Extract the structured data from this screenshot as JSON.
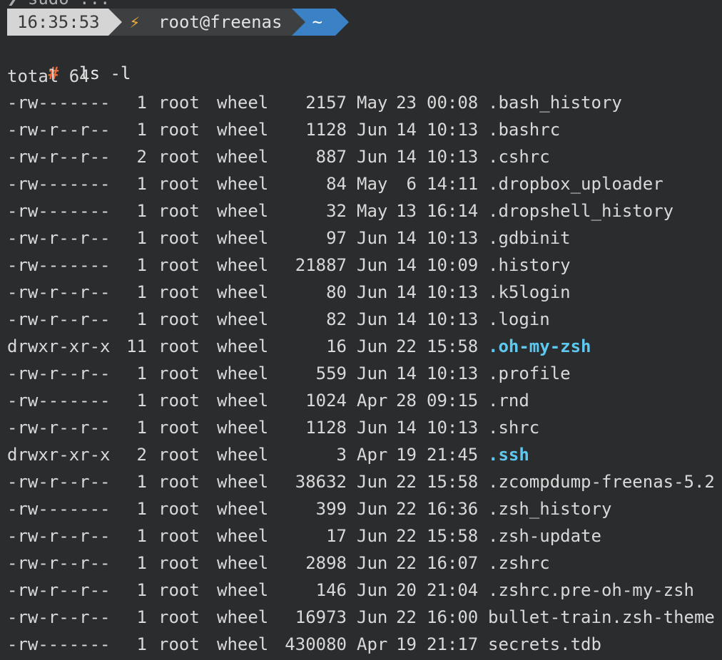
{
  "clipped_line": "❯ sudo ... ",
  "prompt": {
    "time": "16:35:53",
    "status_icon": "⚡",
    "context": "root@freenas",
    "directory": "~"
  },
  "command": {
    "symbol": "#",
    "text": "ls -l"
  },
  "total": "total 64",
  "listing": [
    {
      "perm": "-rw-------",
      "links": "1",
      "user": "root",
      "group": "wheel",
      "size": "2157",
      "month": "May",
      "day": "23",
      "time": "00:08",
      "name": ".bash_history",
      "is_dir": false
    },
    {
      "perm": "-rw-r--r--",
      "links": "1",
      "user": "root",
      "group": "wheel",
      "size": "1128",
      "month": "Jun",
      "day": "14",
      "time": "10:13",
      "name": ".bashrc",
      "is_dir": false
    },
    {
      "perm": "-rw-r--r--",
      "links": "2",
      "user": "root",
      "group": "wheel",
      "size": "887",
      "month": "Jun",
      "day": "14",
      "time": "10:13",
      "name": ".cshrc",
      "is_dir": false
    },
    {
      "perm": "-rw-------",
      "links": "1",
      "user": "root",
      "group": "wheel",
      "size": "84",
      "month": "May",
      "day": "6",
      "time": "14:11",
      "name": ".dropbox_uploader",
      "is_dir": false
    },
    {
      "perm": "-rw-------",
      "links": "1",
      "user": "root",
      "group": "wheel",
      "size": "32",
      "month": "May",
      "day": "13",
      "time": "16:14",
      "name": ".dropshell_history",
      "is_dir": false
    },
    {
      "perm": "-rw-r--r--",
      "links": "1",
      "user": "root",
      "group": "wheel",
      "size": "97",
      "month": "Jun",
      "day": "14",
      "time": "10:13",
      "name": ".gdbinit",
      "is_dir": false
    },
    {
      "perm": "-rw-------",
      "links": "1",
      "user": "root",
      "group": "wheel",
      "size": "21887",
      "month": "Jun",
      "day": "14",
      "time": "10:09",
      "name": ".history",
      "is_dir": false
    },
    {
      "perm": "-rw-r--r--",
      "links": "1",
      "user": "root",
      "group": "wheel",
      "size": "80",
      "month": "Jun",
      "day": "14",
      "time": "10:13",
      "name": ".k5login",
      "is_dir": false
    },
    {
      "perm": "-rw-r--r--",
      "links": "1",
      "user": "root",
      "group": "wheel",
      "size": "82",
      "month": "Jun",
      "day": "14",
      "time": "10:13",
      "name": ".login",
      "is_dir": false
    },
    {
      "perm": "drwxr-xr-x",
      "links": "11",
      "user": "root",
      "group": "wheel",
      "size": "16",
      "month": "Jun",
      "day": "22",
      "time": "15:58",
      "name": ".oh-my-zsh",
      "is_dir": true
    },
    {
      "perm": "-rw-r--r--",
      "links": "1",
      "user": "root",
      "group": "wheel",
      "size": "559",
      "month": "Jun",
      "day": "14",
      "time": "10:13",
      "name": ".profile",
      "is_dir": false
    },
    {
      "perm": "-rw-------",
      "links": "1",
      "user": "root",
      "group": "wheel",
      "size": "1024",
      "month": "Apr",
      "day": "28",
      "time": "09:15",
      "name": ".rnd",
      "is_dir": false
    },
    {
      "perm": "-rw-r--r--",
      "links": "1",
      "user": "root",
      "group": "wheel",
      "size": "1128",
      "month": "Jun",
      "day": "14",
      "time": "10:13",
      "name": ".shrc",
      "is_dir": false
    },
    {
      "perm": "drwxr-xr-x",
      "links": "2",
      "user": "root",
      "group": "wheel",
      "size": "3",
      "month": "Apr",
      "day": "19",
      "time": "21:45",
      "name": ".ssh",
      "is_dir": true
    },
    {
      "perm": "-rw-r--r--",
      "links": "1",
      "user": "root",
      "group": "wheel",
      "size": "38632",
      "month": "Jun",
      "day": "22",
      "time": "15:58",
      "name": ".zcompdump-freenas-5.2",
      "is_dir": false
    },
    {
      "perm": "-rw-------",
      "links": "1",
      "user": "root",
      "group": "wheel",
      "size": "399",
      "month": "Jun",
      "day": "22",
      "time": "16:36",
      "name": ".zsh_history",
      "is_dir": false
    },
    {
      "perm": "-rw-r--r--",
      "links": "1",
      "user": "root",
      "group": "wheel",
      "size": "17",
      "month": "Jun",
      "day": "22",
      "time": "15:58",
      "name": ".zsh-update",
      "is_dir": false
    },
    {
      "perm": "-rw-r--r--",
      "links": "1",
      "user": "root",
      "group": "wheel",
      "size": "2898",
      "month": "Jun",
      "day": "22",
      "time": "16:07",
      "name": ".zshrc",
      "is_dir": false
    },
    {
      "perm": "-rw-r--r--",
      "links": "1",
      "user": "root",
      "group": "wheel",
      "size": "146",
      "month": "Jun",
      "day": "20",
      "time": "21:04",
      "name": ".zshrc.pre-oh-my-zsh",
      "is_dir": false
    },
    {
      "perm": "-rw-r--r--",
      "links": "1",
      "user": "root",
      "group": "wheel",
      "size": "16973",
      "month": "Jun",
      "day": "22",
      "time": "16:00",
      "name": "bullet-train.zsh-theme",
      "is_dir": false
    },
    {
      "perm": "-rw-------",
      "links": "1",
      "user": "root",
      "group": "wheel",
      "size": "430080",
      "month": "Apr",
      "day": "19",
      "time": "21:17",
      "name": "secrets.tdb",
      "is_dir": false
    }
  ],
  "colors": {
    "background": "#2b2c2e",
    "text": "#d9d9d9",
    "directory": "#5ec8f0",
    "prompt_symbol": "#e86a3a",
    "segment_time_bg": "#d5d5d5",
    "segment_context_bg": "#3d3f41",
    "segment_dir_bg": "#3a82c5",
    "status_icon": "#f0a93a"
  }
}
